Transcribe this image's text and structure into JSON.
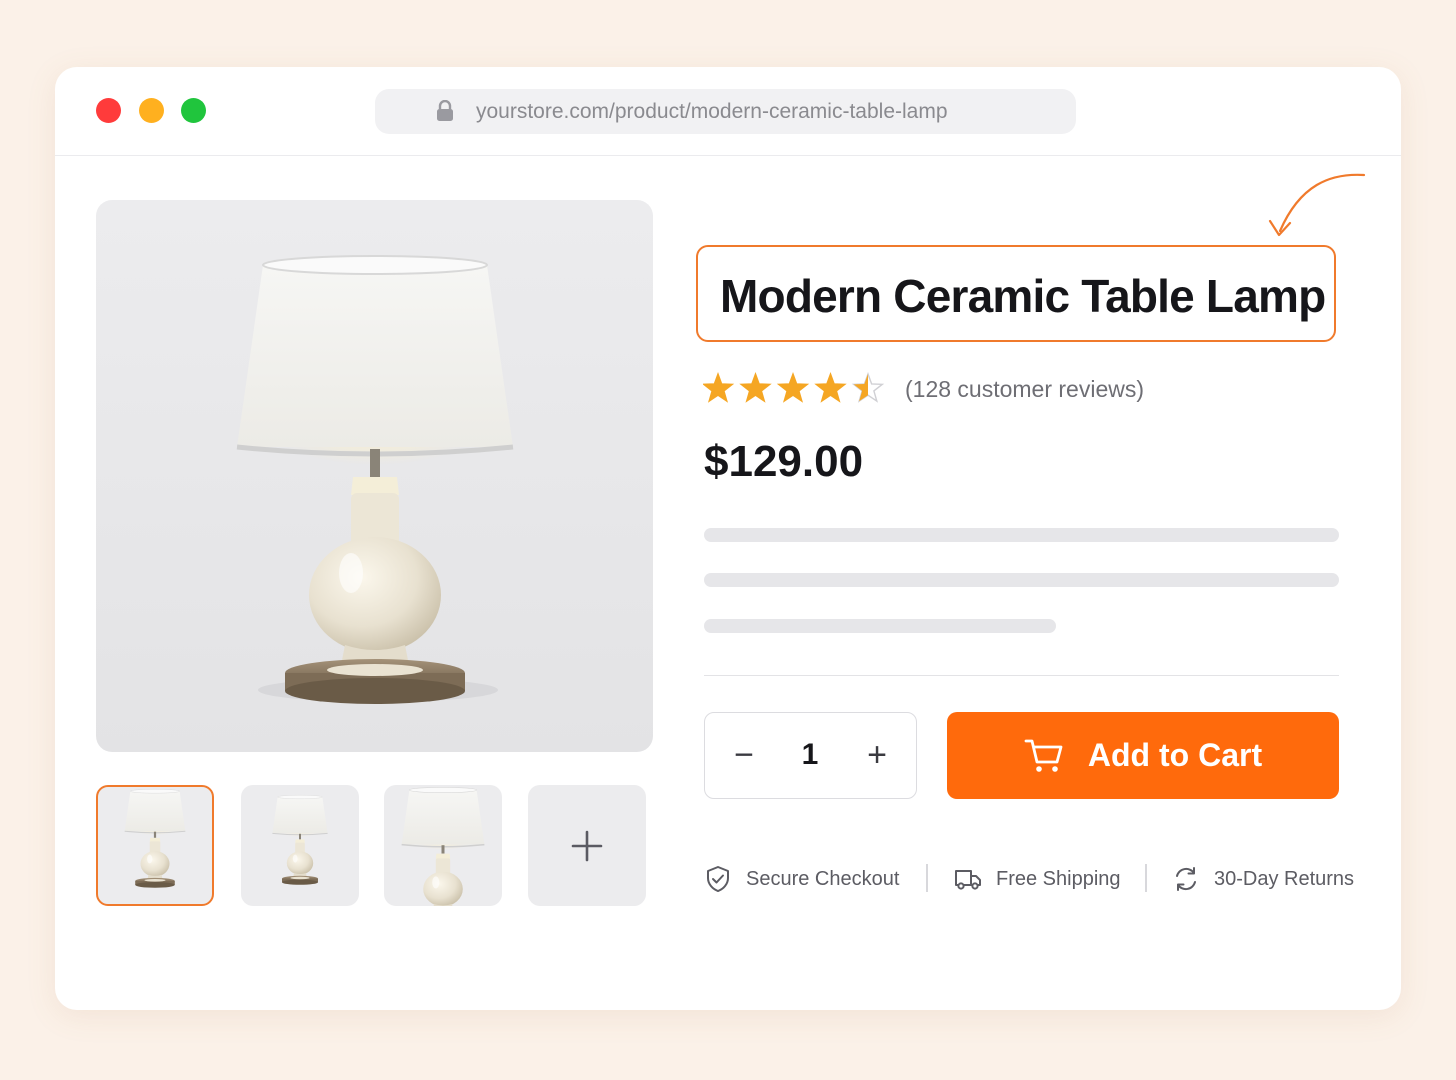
{
  "browser": {
    "url": "yourstore.com/product/modern-ceramic-table-lamp",
    "lock_icon": "lock-icon",
    "traffic_lights": {
      "close": "#ff3b3b",
      "minimize": "#ffb01f",
      "maximize": "#20c53d"
    }
  },
  "gallery": {
    "thumbnails": [
      "thumbnail-lamp-front",
      "thumbnail-lamp-small",
      "thumbnail-lamp-closeup"
    ],
    "active_thumbnail": 0,
    "more_label": "+"
  },
  "product": {
    "title": "Modern Ceramic Table Lamp",
    "rating": 4.5,
    "rating_max": 5,
    "reviews": "(128 customer reviews)",
    "price": "$129.00"
  },
  "purchase": {
    "quantity": "1",
    "decrement_label": "−",
    "increment_label": "+",
    "add_to_cart_label": "Add to Cart"
  },
  "trust_badges": [
    {
      "icon": "shield-check-icon",
      "label": "Secure Checkout"
    },
    {
      "icon": "truck-icon",
      "label": "Free Shipping"
    },
    {
      "icon": "refresh-icon",
      "label": "30-Day Returns"
    }
  ],
  "colors": {
    "accent": "#ff6a0c",
    "highlight_border": "#f07a2c",
    "star": "#f5a623",
    "background": "#fbf1e8"
  }
}
